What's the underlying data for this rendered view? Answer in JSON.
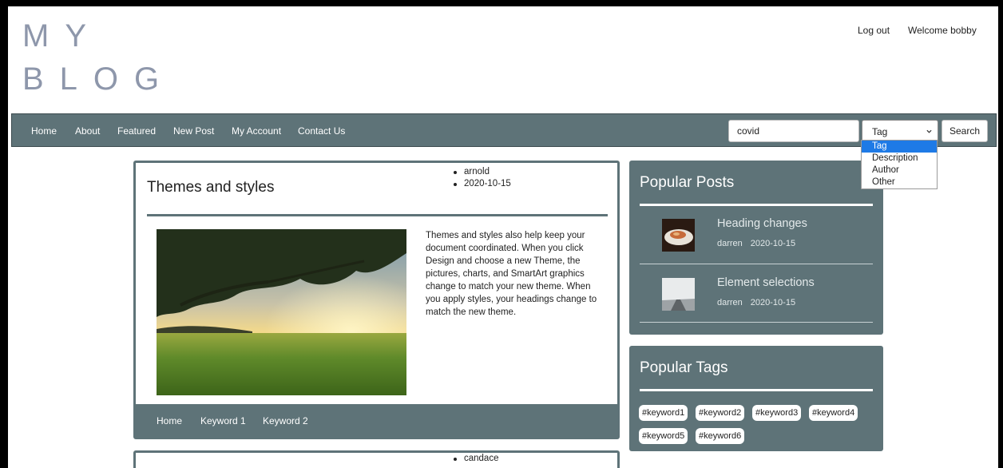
{
  "header": {
    "logo_line1": "MY",
    "logo_line2": "BLOG",
    "logout": "Log out",
    "welcome": "Welcome bobby"
  },
  "nav": {
    "items": [
      "Home",
      "About",
      "Featured",
      "New Post",
      "My Account",
      "Contact Us"
    ],
    "search_value": "covid",
    "select_value": "Tag",
    "select_options": [
      "Tag",
      "Description",
      "Author",
      "Other"
    ],
    "search_button": "Search"
  },
  "posts": [
    {
      "title": "Themes and styles",
      "author": "arnold",
      "date": "2020-10-15",
      "description": "Themes and styles also help keep your document coordinated. When you click Design and choose a new Theme, the pictures, charts, and SmartArt graphics change to match your new theme. When you apply styles, your headings change to match the new theme.",
      "footer_links": [
        "Home",
        "Keyword 1",
        "Keyword 2"
      ]
    },
    {
      "author": "candace"
    }
  ],
  "sidebar": {
    "popular_posts": {
      "title": "Popular Posts",
      "items": [
        {
          "title": "Heading changes",
          "author": "darren",
          "date": "2020-10-15"
        },
        {
          "title": "Element selections",
          "author": "darren",
          "date": "2020-10-15"
        }
      ]
    },
    "popular_tags": {
      "title": "Popular Tags",
      "tags": [
        "#keyword1",
        "#keyword2",
        "#keyword3",
        "#keyword4",
        "#keyword5",
        "#keyword6"
      ]
    }
  },
  "colors": {
    "accent": "#5e7378",
    "logo": "#8e97ab",
    "selected_option": "#1e7ae6"
  }
}
